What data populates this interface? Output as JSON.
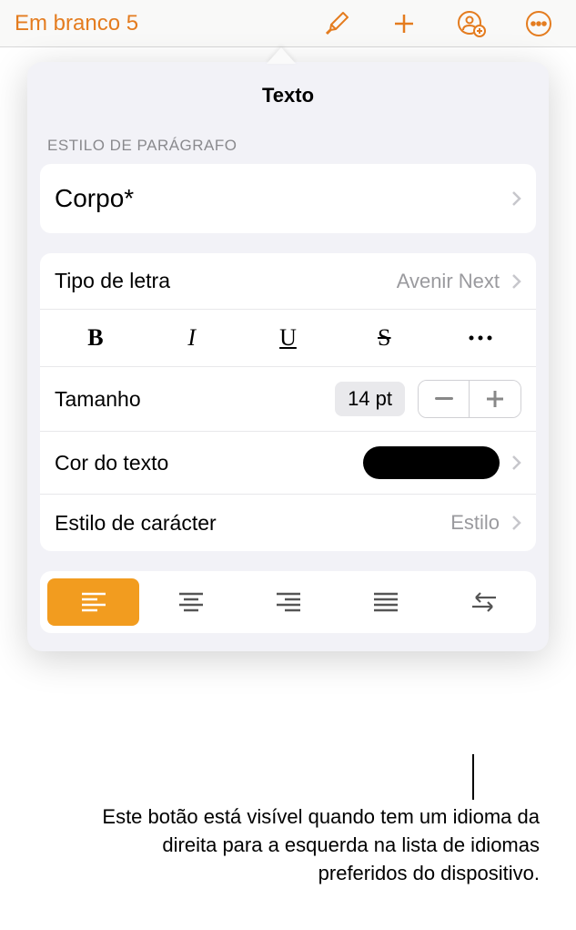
{
  "toolbar": {
    "doc_title": "Em branco 5"
  },
  "popover": {
    "title": "Texto",
    "section_header": "ESTILO DE PARÁGRAFO",
    "paragraph_style": "Corpo*",
    "font_row": {
      "label": "Tipo de letra",
      "value": "Avenir Next"
    },
    "size_row": {
      "label": "Tamanho",
      "value": "14 pt"
    },
    "color_row": {
      "label": "Cor do texto"
    },
    "char_style_row": {
      "label": "Estilo de carácter",
      "value": "Estilo"
    }
  },
  "callout": {
    "text": "Este botão está visível quando tem um idioma da direita para a esquerda na lista de idiomas preferidos do dispositivo."
  }
}
